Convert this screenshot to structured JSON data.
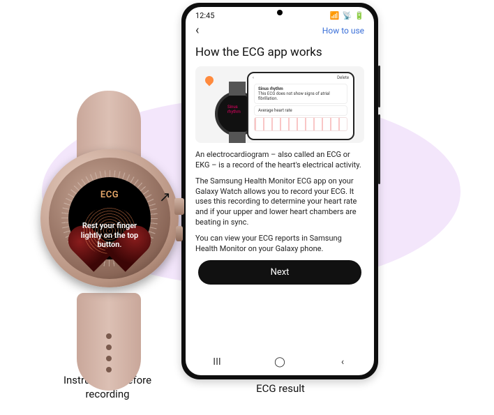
{
  "phone": {
    "status": {
      "time": "12:45",
      "wifi_icon": "wifi-icon",
      "battery_icon": "battery-icon",
      "signal_icon": "signal-icon"
    },
    "appbar": {
      "back_icon": "chevron-left-icon",
      "how_to_use": "How to use"
    },
    "title": "How the ECG app works",
    "illustration": {
      "mini_phone_header_left": "",
      "mini_phone_header_right": "Delete",
      "card1_title": "Sinus rhythm",
      "card1_sub": "This ECG does not show signs of atrial fibrillation.",
      "card2_title": "Average heart rate"
    },
    "paragraphs": [
      "An electrocardiogram – also called an ECG or EKG – is a record of the heart's electrical activity.",
      "The Samsung Health Monitor ECG app on your Galaxy Watch allows you to record your ECG. It uses this recording to determine your heart rate and if your upper and lower heart chambers are beating in sync.",
      "You can view your ECG reports in Samsung Health Monitor on your Galaxy phone."
    ],
    "next_label": "Next",
    "nav": {
      "recents_icon": "recents-icon",
      "home_icon": "home-icon",
      "back_icon": "back-icon"
    }
  },
  "watch": {
    "ecg_label": "ECG",
    "instruction": "Rest your finger lightly on the top button."
  },
  "captions": {
    "watch": "Instructions before recording",
    "phone": "ECG result"
  },
  "colors": {
    "accent_link": "#3a6fd8",
    "watch_accent": "#e9a96b"
  }
}
